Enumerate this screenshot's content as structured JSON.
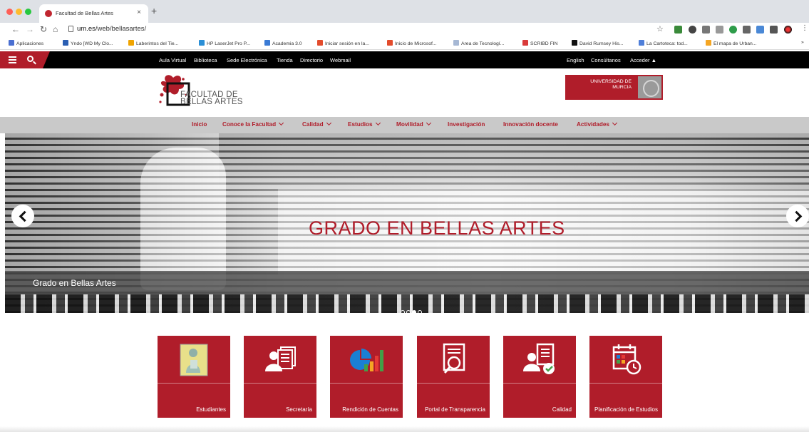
{
  "browser": {
    "tab_title": "Facultad de Bellas Artes",
    "url_domain": "um.es",
    "url_path": "/web/bellasartes/",
    "bookmarks": [
      "Aplicaciones",
      "Yndo [WD My Clo...",
      "Laberintos del Tie...",
      "HP LaserJet Pro P...",
      "Academia 3.0",
      "Iniciar sesión en la...",
      "Inicio de Microsof...",
      "Area de Tecnologí...",
      "SCRIBD FIN",
      "David Rumsey His...",
      "La Cartoteca: tod...",
      "El mapa de Urban..."
    ],
    "bookmark_colors": [
      "#4a6fd1",
      "#2b5fb3",
      "#f0a400",
      "#2b8fd6",
      "#3a7bd5",
      "#e34c2c",
      "#e34c2c",
      "#a6b8d4",
      "#d93a3a",
      "#111111",
      "#4f7fd9",
      "#f5a623"
    ]
  },
  "topbar": {
    "left_links": [
      "Aula Virtual",
      "Biblioteca",
      "Sede Electrónica",
      "Tienda",
      "Directorio",
      "Webmail"
    ],
    "right_links": [
      "English",
      "Consúltanos",
      "Acceder"
    ]
  },
  "header": {
    "logo_line1": "FACULTAD DE",
    "logo_line2": "BELLAS ARTES",
    "university_line1": "UNIVERSIDAD DE",
    "university_line2": "MURCIA"
  },
  "nav": {
    "items": [
      {
        "label": "Inicio",
        "dropdown": false
      },
      {
        "label": "Conoce la Facultad",
        "dropdown": true
      },
      {
        "label": "Calidad",
        "dropdown": true
      },
      {
        "label": "Estudios",
        "dropdown": true
      },
      {
        "label": "Movilidad",
        "dropdown": true
      },
      {
        "label": "Investigación",
        "dropdown": false
      },
      {
        "label": "Innovación docente",
        "dropdown": false
      },
      {
        "label": "Actividades",
        "dropdown": true
      }
    ]
  },
  "hero": {
    "title": "GRADO EN BELLAS ARTES",
    "caption": "Grado en Bellas Artes",
    "slides": 4,
    "active_slide": 2
  },
  "quick_links": [
    {
      "label": "Estudiantes",
      "icon": "student-illustration-icon"
    },
    {
      "label": "Secretaría",
      "icon": "people-documents-icon"
    },
    {
      "label": "Rendición de Cuentas",
      "icon": "pie-bar-chart-icon"
    },
    {
      "label": "Portal de Transparencia",
      "icon": "document-magnifier-icon"
    },
    {
      "label": "Calidad",
      "icon": "user-document-check-icon"
    },
    {
      "label": "Planificación de Estudios",
      "icon": "calendar-clock-icon"
    }
  ],
  "colors": {
    "brand_red": "#b01d2a",
    "nav_gray": "#c9c9c9",
    "topbar_black": "#000000"
  }
}
